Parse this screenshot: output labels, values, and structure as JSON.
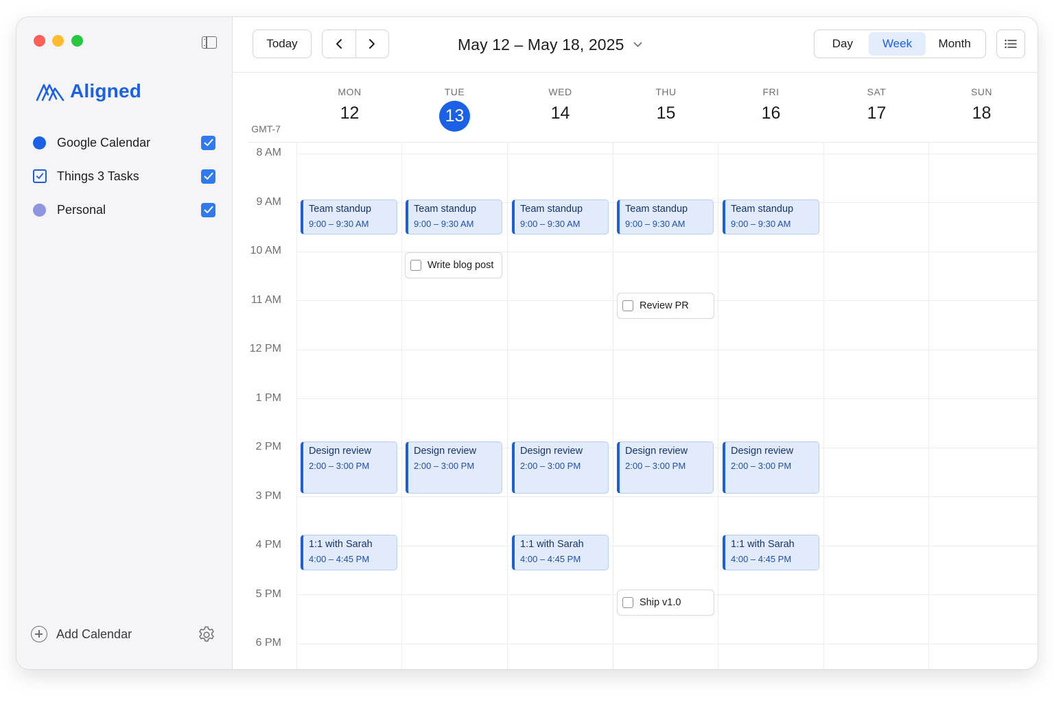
{
  "app": {
    "name": "Aligned",
    "brand_color": "#1a61e6"
  },
  "sidebar": {
    "calendars": [
      {
        "label": "Google Calendar",
        "icon": "dot-icon",
        "color": "#1a61e6",
        "checked": true
      },
      {
        "label": "Things 3 Tasks",
        "icon": "checkbox-square-icon",
        "color": "#1d5fd8",
        "checked": true
      },
      {
        "label": "Personal",
        "icon": "dot-icon",
        "color": "#8e96e2",
        "checked": true
      }
    ],
    "add_calendar_label": "Add Calendar"
  },
  "toolbar": {
    "today_label": "Today",
    "date_range": "May 12 – May 18, 2025",
    "views": [
      "Day",
      "Week",
      "Month"
    ],
    "active_view": "Week"
  },
  "calendar": {
    "timezone": "GMT-7",
    "days": [
      {
        "dow": "MON",
        "num": "12"
      },
      {
        "dow": "TUE",
        "num": "13",
        "today": true
      },
      {
        "dow": "WED",
        "num": "14"
      },
      {
        "dow": "THU",
        "num": "15"
      },
      {
        "dow": "FRI",
        "num": "16"
      },
      {
        "dow": "SAT",
        "num": "17"
      },
      {
        "dow": "SUN",
        "num": "18"
      }
    ],
    "hours": [
      "8 AM",
      "9 AM",
      "10 AM",
      "11 AM",
      "12 PM",
      "1 PM",
      "2 PM",
      "3 PM",
      "4 PM",
      "5 PM",
      "6 PM"
    ],
    "events": [
      {
        "day": 0,
        "title": "Team standup",
        "time": "9:00 – 9:30 AM"
      },
      {
        "day": 1,
        "title": "Team standup",
        "time": "9:00 – 9:30 AM"
      },
      {
        "day": 2,
        "title": "Team standup",
        "time": "9:00 – 9:30 AM"
      },
      {
        "day": 3,
        "title": "Team standup",
        "time": "9:00 – 9:30 AM"
      },
      {
        "day": 4,
        "title": "Team standup",
        "time": "9:00 – 9:30 AM"
      },
      {
        "day": 0,
        "title": "Design review",
        "time": "2:00 – 3:00 PM"
      },
      {
        "day": 1,
        "title": "Design review",
        "time": "2:00 – 3:00 PM"
      },
      {
        "day": 2,
        "title": "Design review",
        "time": "2:00 – 3:00 PM"
      },
      {
        "day": 3,
        "title": "Design review",
        "time": "2:00 – 3:00 PM"
      },
      {
        "day": 4,
        "title": "Design review",
        "time": "2:00 – 3:00 PM"
      },
      {
        "day": 0,
        "title": "1:1 with Sarah",
        "time": "4:00 – 4:45 PM"
      },
      {
        "day": 2,
        "title": "1:1 with Sarah",
        "time": "4:00 – 4:45 PM"
      },
      {
        "day": 4,
        "title": "1:1 with Sarah",
        "time": "4:00 – 4:45 PM"
      }
    ],
    "tasks": [
      {
        "day": 1,
        "label": "Write blog post",
        "checked": false
      },
      {
        "day": 3,
        "label": "Review PR",
        "checked": false
      },
      {
        "day": 3,
        "label": "Ship v1.0",
        "checked": false
      }
    ]
  }
}
